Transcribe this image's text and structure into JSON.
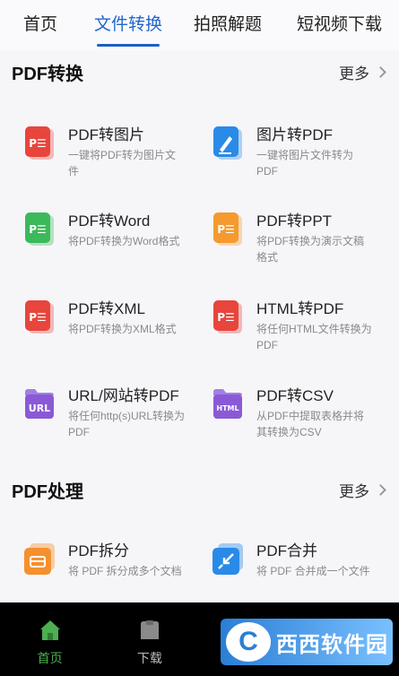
{
  "tabs": [
    {
      "label": "首页"
    },
    {
      "label": "文件转换"
    },
    {
      "label": "拍照解题"
    },
    {
      "label": "短视频下载"
    }
  ],
  "active_tab": 1,
  "sections": {
    "convert": {
      "title": "PDF转换",
      "more": "更多",
      "items": [
        {
          "title": "PDF转图片",
          "desc": "一键将PDF转为图片文件",
          "icon": "pdf-icon",
          "color": "#e8453c"
        },
        {
          "title": "图片转PDF",
          "desc": "一键将图片文件转为PDF",
          "icon": "image-pen-icon",
          "color": "#2a8ae8"
        },
        {
          "title": "PDF转Word",
          "desc": "将PDF转换为Word格式",
          "icon": "pdf-icon",
          "color": "#3cb95a"
        },
        {
          "title": "PDF转PPT",
          "desc": "将PDF转换为演示文稿格式",
          "icon": "pdf-icon",
          "color": "#f59a2e"
        },
        {
          "title": "PDF转XML",
          "desc": "将PDF转换为XML格式",
          "icon": "pdf-icon",
          "color": "#e8453c"
        },
        {
          "title": "HTML转PDF",
          "desc": "将任何HTML文件转换为PDF",
          "icon": "pdf-icon",
          "color": "#e8453c"
        },
        {
          "title": "URL/网站转PDF",
          "desc": "将任何http(s)URL转换为PDF",
          "icon": "url-folder-icon",
          "color": "#8a5ad6",
          "badge": "URL"
        },
        {
          "title": "PDF转CSV",
          "desc": "从PDF中提取表格并将其转换为CSV",
          "icon": "html-folder-icon",
          "color": "#8a5ad6",
          "badge": "HTML"
        }
      ]
    },
    "process": {
      "title": "PDF处理",
      "more": "更多",
      "items": [
        {
          "title": "PDF拆分",
          "desc": "将 PDF 拆分成多个文档",
          "icon": "split-icon",
          "color": "#f5902e"
        },
        {
          "title": "PDF合并",
          "desc": "将 PDF 合并成一个文件",
          "icon": "merge-icon",
          "color": "#2a8ae8"
        }
      ]
    }
  },
  "bottom_nav": [
    {
      "label": "首页",
      "icon": "home-icon"
    },
    {
      "label": "下载",
      "icon": "download-icon"
    },
    {
      "label": "",
      "icon": "toolbox-icon"
    },
    {
      "label": "",
      "icon": "profile-icon"
    }
  ],
  "watermark": {
    "logo": "C",
    "text": "西西软件园"
  },
  "colors": {
    "accent": "#1f5fc4",
    "nav_active": "#4caf50"
  }
}
